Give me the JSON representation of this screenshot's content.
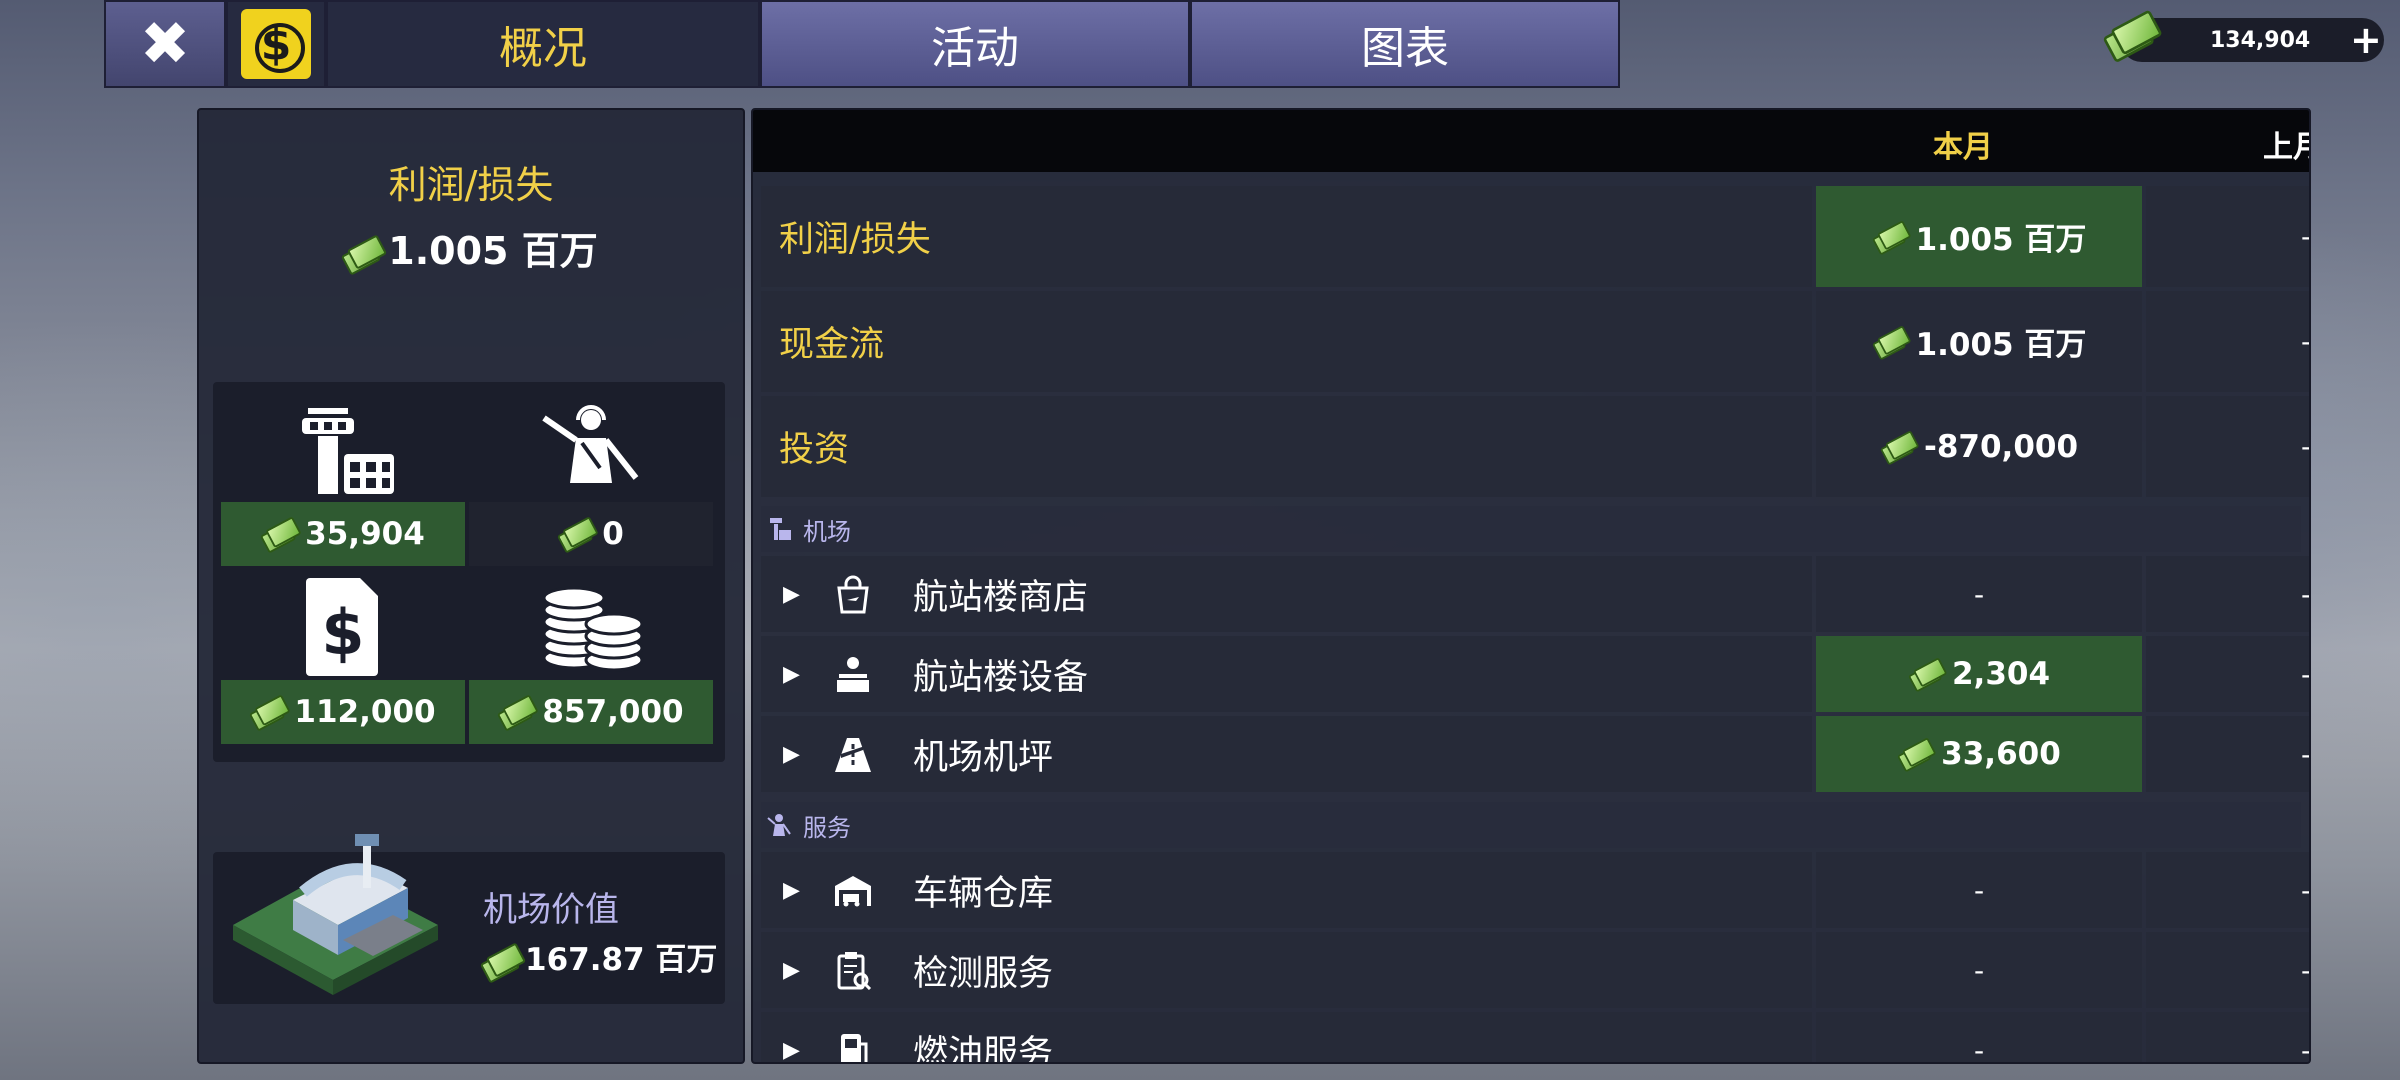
{
  "topbar": {
    "close_label": "✖",
    "tabs": [
      {
        "label": "概况",
        "active": true
      },
      {
        "label": "活动",
        "active": false
      },
      {
        "label": "图表",
        "active": false
      }
    ],
    "currency": "134,904",
    "plus_label": "+"
  },
  "left": {
    "title": "利润/损失",
    "value": "1.005 百万",
    "stats": [
      {
        "icon": "airport-tower-icon",
        "value": "35,904"
      },
      {
        "icon": "staff-marshaller-icon",
        "value": "0"
      },
      {
        "icon": "invoice-dollar-icon",
        "value": "112,000"
      },
      {
        "icon": "coin-stack-icon",
        "value": "857,000"
      }
    ],
    "airport_value_title": "机场价值",
    "airport_value": "167.87 百万"
  },
  "table": {
    "col_current": "本月",
    "col_previous": "上月",
    "summary": [
      {
        "label": "利润/损失",
        "current": "1.005 百万",
        "previous": "-"
      },
      {
        "label": "现金流",
        "current": "1.005 百万",
        "previous": "-"
      },
      {
        "label": "投资",
        "current": "-870,000",
        "previous": "-"
      }
    ],
    "sections": [
      {
        "title": "机场",
        "items": [
          {
            "icon": "shopping-bag-icon",
            "label": "航站楼商店",
            "current": "-",
            "previous": "-"
          },
          {
            "icon": "service-desk-icon",
            "label": "航站楼设备",
            "current": "2,304",
            "previous": "-"
          },
          {
            "icon": "runway-icon",
            "label": "机场机坪",
            "current": "33,600",
            "previous": "-"
          }
        ]
      },
      {
        "title": "服务",
        "items": [
          {
            "icon": "vehicle-garage-icon",
            "label": "车辆仓库",
            "current": "-",
            "previous": "-"
          },
          {
            "icon": "inspection-clipboard-icon",
            "label": "检测服务",
            "current": "-",
            "previous": "-"
          },
          {
            "icon": "fuel-pump-icon",
            "label": "燃油服务",
            "current": "-",
            "previous": "-"
          }
        ]
      }
    ]
  }
}
